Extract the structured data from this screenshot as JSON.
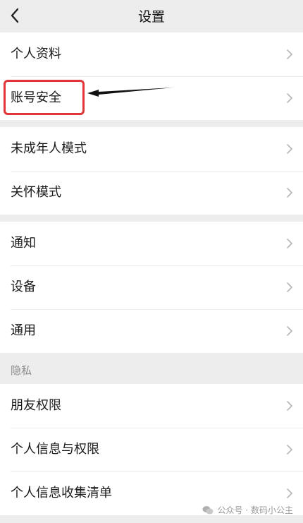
{
  "header": {
    "title": "设置",
    "back_icon": "chevron-left-icon"
  },
  "groups": [
    {
      "items": [
        {
          "label": "个人资料"
        },
        {
          "label": "账号安全"
        }
      ]
    },
    {
      "items": [
        {
          "label": "未成年人模式"
        },
        {
          "label": "关怀模式"
        }
      ]
    },
    {
      "items": [
        {
          "label": "通知"
        },
        {
          "label": "设备"
        },
        {
          "label": "通用"
        }
      ]
    }
  ],
  "privacy": {
    "section_label": "隐私",
    "items": [
      {
        "label": "朋友权限"
      },
      {
        "label": "个人信息与权限"
      },
      {
        "label": "个人信息收集清单"
      }
    ]
  },
  "annotation": {
    "highlighted_item": "账号安全",
    "color": "#e0363a"
  },
  "watermark": {
    "text": "公众号 · 数码小公主"
  }
}
